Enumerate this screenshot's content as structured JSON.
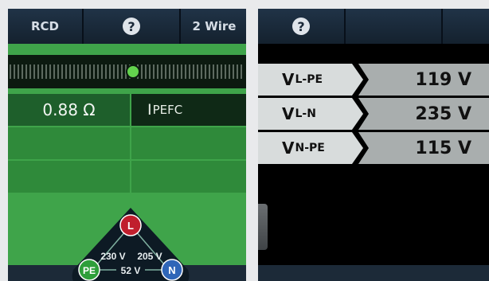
{
  "left": {
    "toolbar": {
      "mode_label": "RCD",
      "help_glyph": "?",
      "wiring_label": "2 Wire"
    },
    "result": {
      "value": "0.88 Ω",
      "label_main": "I",
      "label_sub": "PEFC"
    },
    "triangle": {
      "node_l": "L",
      "node_pe": "PE",
      "node_n": "N",
      "v_l_pe": "230 V",
      "v_l_n": "205 V",
      "v_n_pe": "52 V"
    },
    "colors": {
      "background": "#3fa44a",
      "node_l": "#c01f2d",
      "node_pe": "#2e9e3a",
      "node_n": "#2f66b8"
    }
  },
  "right": {
    "toolbar": {
      "help_glyph": "?"
    },
    "rows": [
      {
        "label": "V",
        "sub": "L-PE",
        "value": "119 V"
      },
      {
        "label": "V",
        "sub": "L-N",
        "value": "235 V"
      },
      {
        "label": "V",
        "sub": "N-PE",
        "value": "115 V"
      }
    ]
  }
}
